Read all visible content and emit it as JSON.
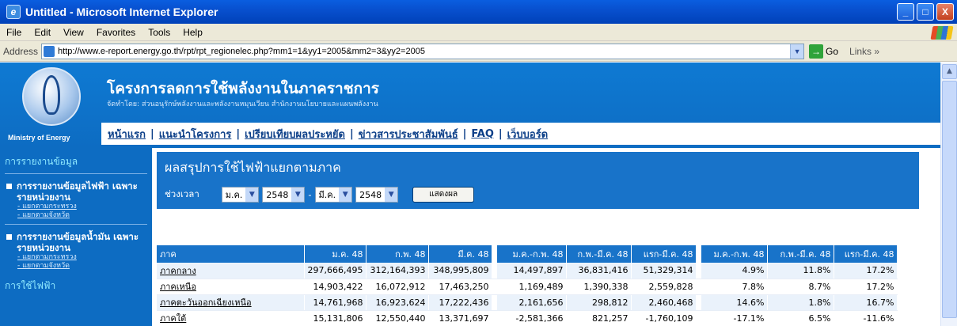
{
  "window": {
    "title": "Untitled - Microsoft Internet Explorer",
    "buttons": [
      "_",
      "□",
      "X"
    ]
  },
  "menu": [
    "File",
    "Edit",
    "View",
    "Favorites",
    "Tools",
    "Help"
  ],
  "address": {
    "label": "Address",
    "url": "http://www.e-report.energy.go.th/rpt/rpt_regionelec.php?mm1=1&yy1=2005&mm2=3&yy2=2005",
    "go": "Go",
    "links": "Links »"
  },
  "site": {
    "title": "โครงการลดการใช้พลังงานในภาคราชการ",
    "subtitle": "จัดทำโดย: ส่วนอนุรักษ์พลังงานและพลังงานหมุนเวียน สำนักงานนโยบายและแผนพลังงาน",
    "ministry": "Ministry of Energy"
  },
  "nav": [
    "หน้าแรก",
    "แนะนำโครงการ",
    "เปรียบเทียบผลประหยัด",
    "ข่าวสารประชาสัมพันธ์",
    "FAQ",
    "เว็บบอร์ด"
  ],
  "sidebar": {
    "heading": "การรายงานข้อมูล",
    "sections": [
      {
        "title": "การรายงานข้อมูลไฟฟ้า เฉพาะรายหน่วยงาน",
        "links": [
          "- แยกตามกระทรวง",
          "- แยกตามจังหวัด"
        ]
      },
      {
        "title": "การรายงานข้อมูลน้ำมัน เฉพาะรายหน่วยงาน",
        "links": [
          "- แยกตามกระทรวง",
          "- แยกตามจังหวัด"
        ]
      }
    ],
    "footer": "การใช้ไฟฟ้า"
  },
  "panel": {
    "title": "ผลสรุปการใช้ไฟฟ้าแยกตามภาค",
    "period_label": "ช่วงเวลา",
    "month1": "ม.ค.",
    "year1": "2548",
    "dash": "-",
    "month2": "มี.ค.",
    "year2": "2548",
    "button": "แสดงผล"
  },
  "table": {
    "headers": [
      "ภาค",
      "ม.ค. 48",
      "ก.พ. 48",
      "มี.ค. 48",
      "ม.ค.-ก.พ. 48",
      "ก.พ.-มี.ค. 48",
      "แรก-มี.ค. 48",
      "ม.ค.-ก.พ. 48",
      "ก.พ.-มี.ค. 48",
      "แรก-มี.ค. 48"
    ],
    "rows": [
      [
        "ภาคกลาง",
        "297,666,495",
        "312,164,393",
        "348,995,809",
        "14,497,897",
        "36,831,416",
        "51,329,314",
        "4.9%",
        "11.8%",
        "17.2%"
      ],
      [
        "ภาคเหนือ",
        "14,903,422",
        "16,072,912",
        "17,463,250",
        "1,169,489",
        "1,390,338",
        "2,559,828",
        "7.8%",
        "8.7%",
        "17.2%"
      ],
      [
        "ภาคตะวันออกเฉียงเหนือ",
        "14,761,968",
        "16,923,624",
        "17,222,436",
        "2,161,656",
        "298,812",
        "2,460,468",
        "14.6%",
        "1.8%",
        "16.7%"
      ],
      [
        "ภาคใต้",
        "15,131,806",
        "12,550,440",
        "13,371,697",
        "-2,581,366",
        "821,257",
        "-1,760,109",
        "-17.1%",
        "6.5%",
        "-11.6%"
      ]
    ]
  }
}
